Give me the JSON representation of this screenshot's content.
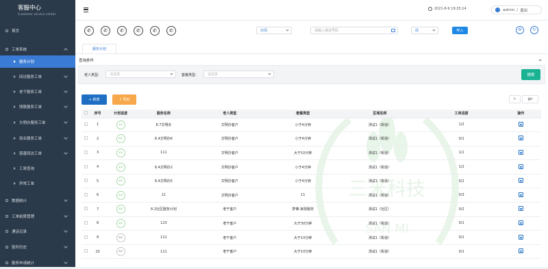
{
  "brand": {
    "title": "客服中心",
    "subtitle": "Customer service center"
  },
  "menu": [
    {
      "label": "首页",
      "expandable": false
    },
    {
      "label": "工单系统",
      "expandable": true,
      "expanded": true
    },
    {
      "label": "服务计划",
      "sub": true,
      "active": true
    },
    {
      "label": "回访服务工单",
      "sub": true,
      "expandable": true
    },
    {
      "label": "老干服务工单",
      "sub": true,
      "expandable": true
    },
    {
      "label": "残联服务工单",
      "sub": true,
      "expandable": true
    },
    {
      "label": "文明办服务工单",
      "sub": true,
      "expandable": true
    },
    {
      "label": "商业服务工单",
      "sub": true,
      "expandable": true
    },
    {
      "label": "慈善回访工单",
      "sub": true,
      "expandable": true
    },
    {
      "label": "工单查询",
      "sub": true
    },
    {
      "label": "异常工单",
      "sub": true
    },
    {
      "label": "数据统计",
      "expandable": true
    },
    {
      "label": "工单结算管理",
      "expandable": true
    },
    {
      "label": "通话记录",
      "expandable": true
    },
    {
      "label": "取件历史",
      "expandable": true
    },
    {
      "label": "服务申请统计",
      "expandable": true
    }
  ],
  "header": {
    "datetime": "2021-8-9 19:25:14",
    "username": "admin",
    "separator": "/",
    "logout": "退出"
  },
  "toolbar": {
    "status_select": "示闲",
    "search_placeholder": "请输入通话号码",
    "combo_select": "前",
    "call_button": "呼入"
  },
  "tab": {
    "label": "服务计划"
  },
  "query": {
    "title": "查询条件",
    "elder_type_label": "老人类型:",
    "elder_type_placeholder": "请选择",
    "package_type_label": "套餐类型:",
    "package_type_placeholder": "请选择",
    "search_button": "搜索"
  },
  "actions": {
    "new_label": "+ 新增",
    "export_label": "⇧ 导出"
  },
  "table": {
    "headers": [
      "序号",
      "计划进度",
      "服务名称",
      "老人类型",
      "套餐类型",
      "区域名称",
      "工单进度",
      "操作"
    ],
    "rows": [
      {
        "no": "1",
        "progress": "1/2",
        "name": "8.7文明办",
        "elder": "文明办客户",
        "package": "小于4分钟",
        "area": "测试1（街道）",
        "order": "1/2"
      },
      {
        "no": "2",
        "progress": "0/1",
        "name": "8.4文明办6",
        "elder": "文明办客户",
        "package": "小于4分钟",
        "area": "测试1（街道）",
        "order": "0/1"
      },
      {
        "no": "3",
        "progress": "1/1",
        "name": "111",
        "elder": "文明办客户",
        "package": "大于10分钟",
        "area": "测试1（街道）",
        "order": "1/1"
      },
      {
        "no": "4",
        "progress": "1/2",
        "name": "8.4文明办2",
        "elder": "文明办客户",
        "package": "小于4分钟",
        "area": "测试1（街道）",
        "order": "1/2"
      },
      {
        "no": "5",
        "progress": "0/2",
        "name": "8.4文明办5",
        "elder": "文明办客户",
        "package": "小于4分钟",
        "area": "测试1（街道）",
        "order": "0/2"
      },
      {
        "no": "6",
        "progress": "0/3",
        "name": "11",
        "elder": "文明办客户",
        "package": "11",
        "area": "测试1（街道）",
        "order": "0/3"
      },
      {
        "no": "7",
        "progress": "0/2",
        "name": "8.2社区服务计划",
        "elder": "老干客户",
        "package": "梦佛-家政服务",
        "area": "测试1（社区）",
        "order": "0/2"
      },
      {
        "no": "8",
        "progress": "0/1",
        "name": "123",
        "elder": "老干客户",
        "package": "大于30分钟",
        "area": "测试1（街道）",
        "order": "0/1"
      },
      {
        "no": "9",
        "progress": "0/1",
        "name": "111",
        "elder": "老干客户",
        "package": "大于10分钟",
        "area": "测试1（街道）",
        "order": "0/1"
      },
      {
        "no": "10",
        "progress": "0/1",
        "name": "111",
        "elder": "老干客户",
        "package": "大于10分钟",
        "area": "测试1（街道）",
        "order": "0/1"
      }
    ]
  },
  "watermark": {
    "text_cn": "三米科技",
    "text_en": "SAN MI"
  },
  "colors": {
    "sidebar_bg": "#2b3a4a",
    "active": "#3a7bd5",
    "primary_btn": "#1e88e5",
    "search_btn": "#19b394",
    "export_btn": "#f7a84a",
    "progress": "#4caf50"
  },
  "icons": {
    "toolbar_phones": [
      "phone-icon",
      "phone-hangup-icon",
      "phone-transfer-icon",
      "phone-hold-icon",
      "phone-wifi-icon",
      "phone-forward-icon"
    ],
    "row_action": "detail-doc-icon"
  }
}
